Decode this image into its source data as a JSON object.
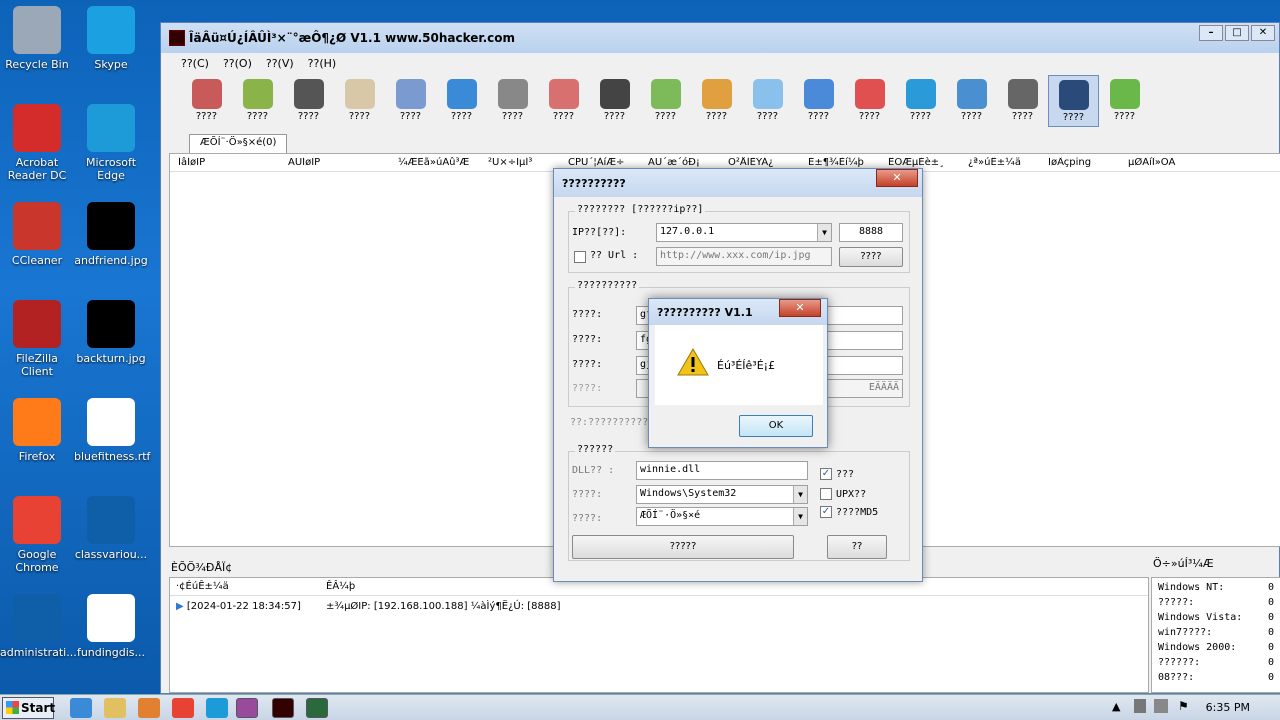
{
  "desktop": {
    "icons": [
      {
        "label": "Recycle Bin",
        "color": "#9aa8b8"
      },
      {
        "label": "Skype",
        "color": "#1ba1e2"
      },
      {
        "label": "Acrobat Reader DC",
        "color": "#d42b2b"
      },
      {
        "label": "Microsoft Edge",
        "color": "#1c9bd8"
      },
      {
        "label": "CCleaner",
        "color": "#c9362c"
      },
      {
        "label": "andfriend.jpg",
        "color": "#000000"
      },
      {
        "label": "FileZilla Client",
        "color": "#b32222"
      },
      {
        "label": "backturn.jpg",
        "color": "#000000"
      },
      {
        "label": "Firefox",
        "color": "#ff7b1a"
      },
      {
        "label": "bluefitness.rtf",
        "color": "#ffffff"
      },
      {
        "label": "Google Chrome",
        "color": "#e84235"
      },
      {
        "label": "classvariou...",
        "color": "#0e5fa8"
      },
      {
        "label": "administrati...",
        "color": "#0e5fa8"
      },
      {
        "label": "fundingdis...",
        "color": "#ffffff"
      }
    ]
  },
  "app": {
    "title": "ÎäÂü¤Ú¿ÍÂÛÌ³×¨°æÔ¶¿Ø V1.1 www.50hacker.com",
    "menu": [
      "??(C)",
      "??(O)",
      "??(V)",
      "??(H)"
    ],
    "toolbar": [
      {
        "label": "????",
        "color": "#c85a5a"
      },
      {
        "label": "????",
        "color": "#8ab44a"
      },
      {
        "label": "????",
        "color": "#555555"
      },
      {
        "label": "????",
        "color": "#d8c8a8"
      },
      {
        "label": "????",
        "color": "#7a9ad0"
      },
      {
        "label": "????",
        "color": "#3a8ad8"
      },
      {
        "label": "????",
        "color": "#888888"
      },
      {
        "label": "????",
        "color": "#d87070"
      },
      {
        "label": "????",
        "color": "#444444"
      },
      {
        "label": "????",
        "color": "#7cba5a"
      },
      {
        "label": "????",
        "color": "#e0a040"
      },
      {
        "label": "????",
        "color": "#8ac0ec"
      },
      {
        "label": "????",
        "color": "#4a8ad8"
      },
      {
        "label": "????",
        "color": "#e05050"
      },
      {
        "label": "????",
        "color": "#2a9ad8"
      },
      {
        "label": "????",
        "color": "#4a90d0"
      },
      {
        "label": "????",
        "color": "#666666"
      },
      {
        "label": "????",
        "color": "#2a4a7a"
      },
      {
        "label": "????",
        "color": "#6ab84a"
      }
    ],
    "tab": "ÆÕÍ¨·Ö»§×é(0)",
    "columns": [
      "ÍâÍøIP",
      "ÄÚÍøIP",
      "¼ÆËã»úÃû³Æ",
      "²Ù×÷ÏµÍ³",
      "CPU´¦ÀíÆ÷",
      "ÄÚ´æ´óÐ¡",
      "Ó²ÅÌÈÝÁ¿",
      "É±¶¾Èí¼þ",
      "ÊÓÆµÉè±¸",
      "¿ª»úÊ±¼ä",
      "ÍøÂçping",
      "µØÀíÎ»ÖÃ"
    ],
    "log": {
      "title": "ÈÕÖ¾ÐÅÏ¢",
      "col_time": "·¢ÉúÊ±¼ä",
      "col_event": "ÊÂ¼þ",
      "rows": [
        {
          "time": "[2024-01-22 18:34:57]",
          "event": "±¾µØIP: [192.168.100.188] ¼àÌý¶Ë¿Ú: [8888]"
        }
      ]
    },
    "stats": {
      "title": "Ö÷»úÍ³¼Æ",
      "rows": [
        {
          "label": "Windows NT:",
          "value": "0"
        },
        {
          "label": "?????:",
          "value": "0"
        },
        {
          "label": "Windows Vista:",
          "value": "0"
        },
        {
          "label": "win7????:",
          "value": "0"
        },
        {
          "label": "Windows 2000:",
          "value": "0"
        },
        {
          "label": "??????:",
          "value": "0"
        },
        {
          "label": "08???:",
          "value": "0"
        }
      ]
    }
  },
  "dialog": {
    "title": "??????????",
    "group1": "???????? [??????ip??]",
    "ip_label": "IP??[??]:",
    "ip_value": "127.0.0.1",
    "port": "8888",
    "url_label": "?? Url :",
    "url_value": "http://www.xxx.com/ip.jpg",
    "url_btn": "????",
    "group2": "??????????",
    "fields": [
      {
        "label": "????:",
        "value": "gf"
      },
      {
        "label": "????:",
        "value": "fg"
      },
      {
        "label": "????:",
        "value": "gj"
      },
      {
        "label": "????:",
        "value": "EÄÄÄÄ"
      }
    ],
    "hint": "??:??????????",
    "group3": "??????",
    "dll_label": "DLL?? :",
    "dll_value": "winnie.dll",
    "dir_label": "????:",
    "dir_value": "Windows\\System32",
    "grp_label": "????:",
    "grp_value": "ÆÕÍ¨·Ö»§×é",
    "chk1": "???",
    "chk2": "UPX??",
    "chk3": "????MD5",
    "gen_btn": "?????",
    "close_btn": "??"
  },
  "msgbox": {
    "title": "?????????? V1.1",
    "text": "Éú³ÉÍê³É¡£",
    "ok": "OK"
  },
  "taskbar": {
    "start": "Start",
    "clock": "6:35 PM"
  }
}
